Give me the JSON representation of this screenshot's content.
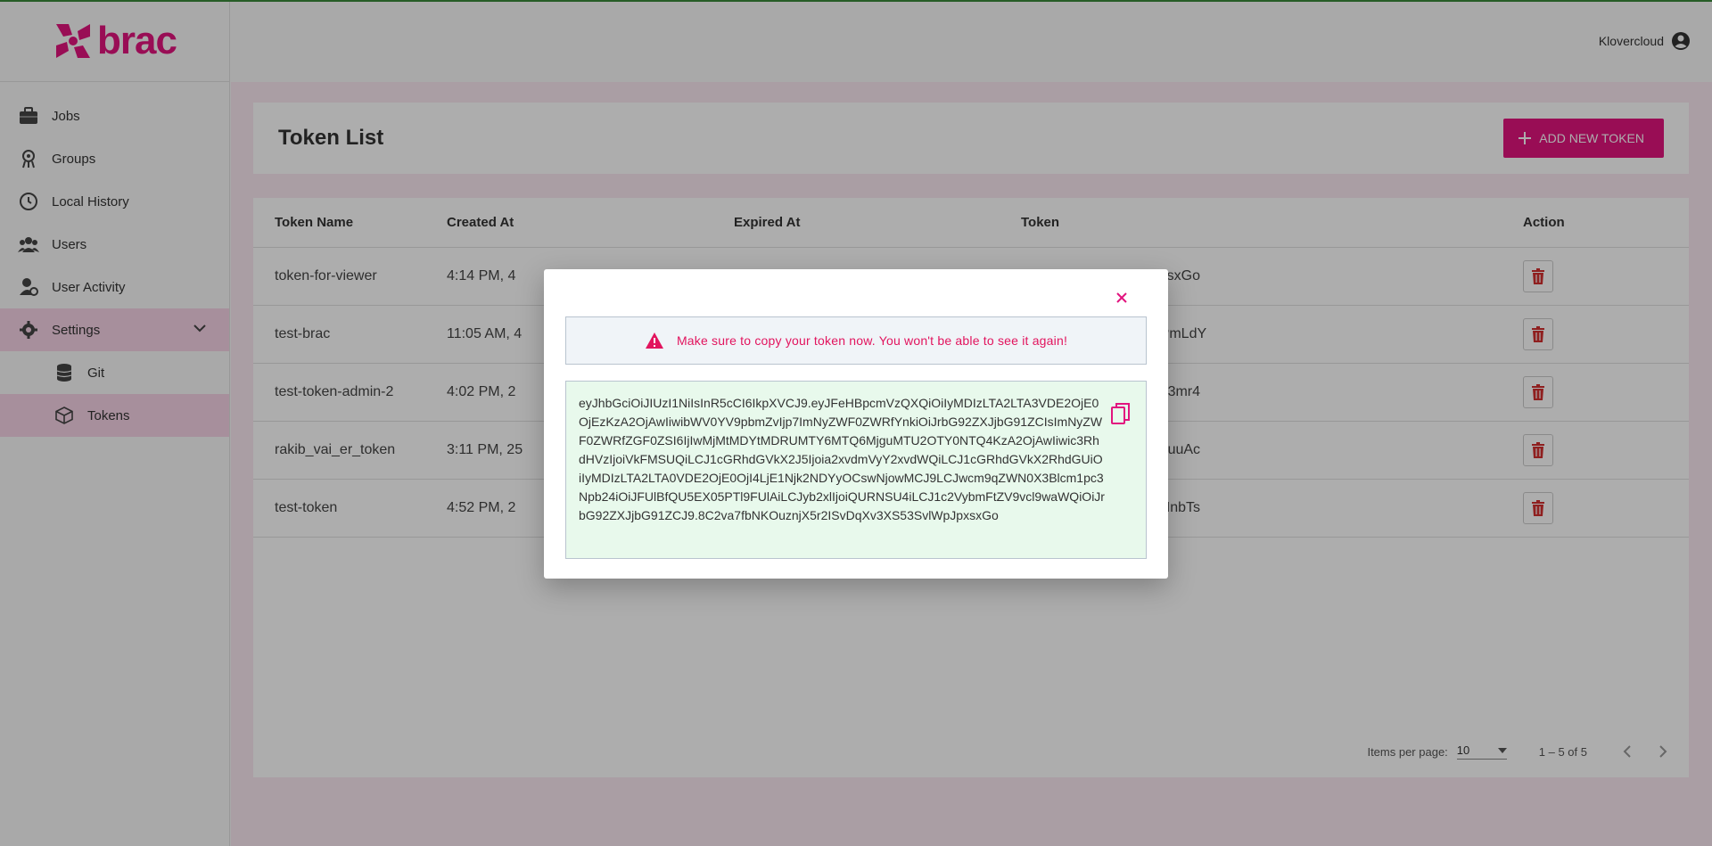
{
  "app": {
    "logo_text": "brac",
    "user_name": "Klovercloud"
  },
  "sidebar": {
    "items": [
      {
        "label": "Jobs",
        "icon": "briefcase-icon"
      },
      {
        "label": "Groups",
        "icon": "groups-icon"
      },
      {
        "label": "Local History",
        "icon": "history-icon"
      },
      {
        "label": "Users",
        "icon": "users-icon"
      },
      {
        "label": "User Activity",
        "icon": "user-activity-icon"
      },
      {
        "label": "Settings",
        "icon": "gear-icon"
      }
    ],
    "sub_items": [
      {
        "label": "Git",
        "icon": "database-icon"
      },
      {
        "label": "Tokens",
        "icon": "cube-icon"
      }
    ]
  },
  "page": {
    "title": "Token List",
    "add_button_label": "ADD NEW TOKEN"
  },
  "table": {
    "headers": [
      "Token Name",
      "Created At",
      "Expired At",
      "Token",
      "Action"
    ],
    "rows": [
      {
        "name": "token-for-viewer",
        "created": "4:14 PM, 4",
        "expired": "",
        "token": "*************************xsxGo"
      },
      {
        "name": "test-brac",
        "created": "11:05 AM, 4",
        "expired": "",
        "token": "*************************PmLdY"
      },
      {
        "name": "test-token-admin-2",
        "created": "4:02 PM, 2",
        "expired": "",
        "token": "*************************n3mr4"
      },
      {
        "name": "rakib_vai_er_token",
        "created": "3:11 PM, 25",
        "expired": "",
        "token": "*************************4uuAc"
      },
      {
        "name": "test-token",
        "created": "4:52 PM, 2",
        "expired": "",
        "token": "*************************HnbTs"
      }
    ]
  },
  "paginator": {
    "items_per_page_label": "Items per page:",
    "page_size": "10",
    "range_label": "1 – 5 of 5"
  },
  "modal": {
    "warning_text": "Make sure to copy your token now. You won't be able to see it again!",
    "token_value": "eyJhbGciOiJIUzI1NiIsInR5cCI6IkpXVCJ9.eyJFeHBpcmVzQXQiOiIyMDIzLTA2LTA3VDE2OjE0OjEzKzA2OjAwIiwibWV0YV9pbmZvIjp7ImNyZWF0ZWRfYnkiOiJrbG92ZXJjbG91ZCIsImNyZWF0ZWRfZGF0ZSI6IjIwMjMtMDYtMDRUMTY6MTQ6MjguMTU2OTY0NTQ4KzA2OjAwIiwic3RhdHVzIjoiVkFMSUQiLCJ1cGRhdGVkX2J5Ijoia2xvdmVyY2xvdWQiLCJ1cGRhdGVkX2RhdGUiOiIyMDIzLTA2LTA0VDE2OjE0OjI4LjE1Njk2NDYyOCswNjowMCJ9LCJwcm9qZWN0X3Blcm1pc3Npb24iOiJFUlBfQU5EX05PTl9FUlAiLCJyb2xlIjoiQURNSU4iLCJ1c2VybmFtZV9vcl9waWQiOiJrbG92ZXJjbG91ZCJ9.8C2va7fbNKOuznjX5r2ISvDqXv3XS53SvlWpJpxsxGo",
    "colors": {
      "accent": "#e2147e",
      "token_bg": "#e8f9ec",
      "warning_bg": "#f0f4f8"
    }
  }
}
